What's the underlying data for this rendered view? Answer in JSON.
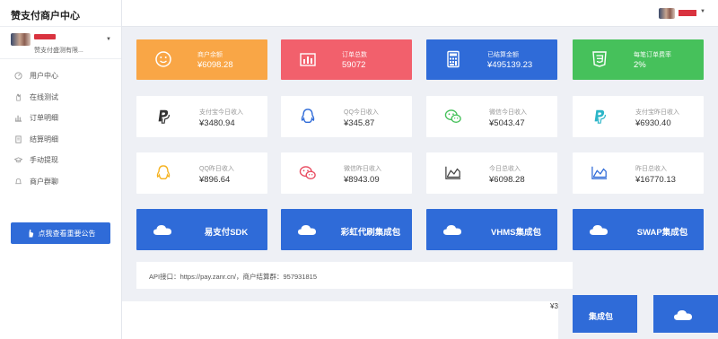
{
  "brand": "赞支付商户中心",
  "profile": {
    "name": "赞支付盛测有限..."
  },
  "nav": [
    {
      "label": "用户中心",
      "icon": "gauge-icon"
    },
    {
      "label": "在线测试",
      "icon": "hand-icon"
    },
    {
      "label": "订单明细",
      "icon": "bar-chart-icon"
    },
    {
      "label": "结算明细",
      "icon": "document-icon"
    },
    {
      "label": "手动提现",
      "icon": "graduation-cap-icon"
    },
    {
      "label": "商户群聊",
      "icon": "bell-icon"
    }
  ],
  "notice_button": "点我查看重要公告",
  "stats": [
    {
      "label": "商户余额",
      "value": "¥6098.28",
      "color": "#f9a646",
      "icon": "smile-icon"
    },
    {
      "label": "订单总数",
      "value": "59072",
      "color": "#f2606c",
      "icon": "bar-chart-icon"
    },
    {
      "label": "已结算金额",
      "value": "¥495139.23",
      "color": "#2f6bd8",
      "icon": "calculator-icon"
    },
    {
      "label": "每笔订单费率",
      "value": "2%",
      "color": "#46c15b",
      "icon": "css3-icon"
    }
  ],
  "today": [
    {
      "label": "支付宝今日收入",
      "value": "¥3480.94",
      "icon": "paypal-icon"
    },
    {
      "label": "QQ今日收入",
      "value": "¥345.87",
      "icon": "qq-icon"
    },
    {
      "label": "微信今日收入",
      "value": "¥5043.47",
      "icon": "wechat-icon"
    },
    {
      "label": "支付宝昨日收入",
      "value": "¥6930.40",
      "icon": "paypal-icon"
    }
  ],
  "yesterday": [
    {
      "label": "QQ昨日收入",
      "value": "¥896.64",
      "icon": "qq-icon"
    },
    {
      "label": "微信昨日收入",
      "value": "¥8943.09",
      "icon": "wechat-icon"
    },
    {
      "label": "今日总收入",
      "value": "¥6098.28",
      "icon": "area-chart-icon"
    },
    {
      "label": "昨日总收入",
      "value": "¥16770.13",
      "icon": "area-chart-icon"
    }
  ],
  "downloads": [
    {
      "label": "易支付SDK",
      "icon": "cloud-icon"
    },
    {
      "label": "彩虹代刷集成包",
      "icon": "cloud-icon"
    },
    {
      "label": "VHMS集成包",
      "icon": "cloud-icon"
    },
    {
      "label": "SWAP集成包",
      "icon": "cloud-icon"
    }
  ],
  "api_info": "API接口：https://pay.zanr.cn/，商户结算群：957931815",
  "fragment": {
    "value": "¥3",
    "label": "集成包"
  },
  "colors": {
    "primary": "#2f6bd8",
    "orange": "#f9a646",
    "red": "#f2606c",
    "green": "#46c15b"
  }
}
